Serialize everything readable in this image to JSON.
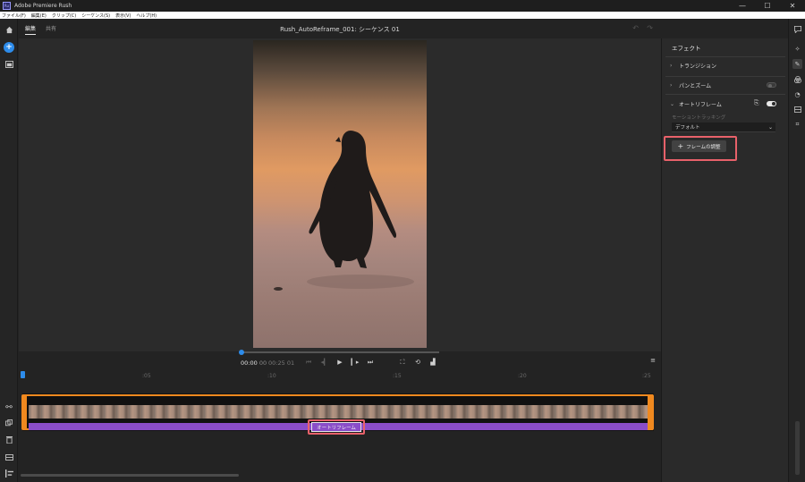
{
  "titlebar": {
    "logo": "Ru",
    "title": "Adobe Premiere Rush",
    "minimize": "—",
    "maximize": "☐",
    "close": "✕"
  },
  "menubar": [
    "ファイル(F)",
    "編集(E)",
    "クリップ(C)",
    "シーケンス(S)",
    "表示(V)",
    "ヘルプ(H)"
  ],
  "leftbar": {
    "icons": [
      "home-icon",
      "add-icon",
      "media-icon",
      "link-icon",
      "duplicate-icon",
      "trash-icon",
      "track-icon",
      "list-icon"
    ]
  },
  "header": {
    "tabs": [
      "編集",
      "共有"
    ],
    "sequence_title": "Rush_AutoReframe_001: シーケンス 01"
  },
  "controls": {
    "current_time": "00:00",
    "current_frames": "00",
    "duration": "00:25",
    "duration_frames": "01"
  },
  "timeline": {
    "ruler_labels": [
      ":05",
      ":10",
      ":15",
      ":20",
      ":25"
    ],
    "effect_label": "オートリフレーム"
  },
  "effects_panel": {
    "title": "エフェクト",
    "transition_label": "トランジション",
    "pan_zoom_label": "パンとズーム",
    "autoreframe_label": "オートリフレーム",
    "motion_tracking_label": "モーショントラッキング",
    "motion_tracking_value": "デフォルト",
    "adjust_frame_label": "フレームの調整",
    "pan_zoom_enabled": false,
    "autoreframe_enabled": true
  },
  "colors": {
    "accent": "#2d8ceb",
    "clip_border": "#f0891f",
    "effect_bar": "#8a4dc9",
    "highlight": "#e8616a"
  }
}
